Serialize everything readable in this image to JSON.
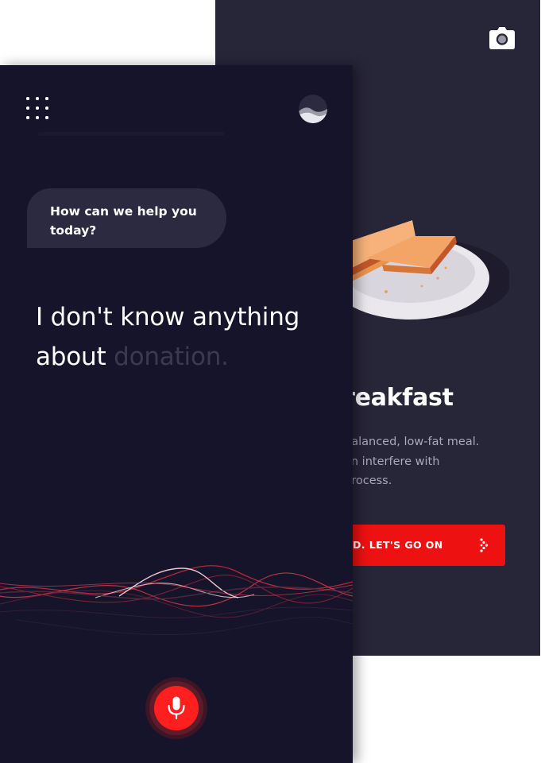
{
  "back_screen": {
    "title": "breakfast",
    "description_lines": [
      "balanced, low-fat meal.",
      "an interfere with",
      "process."
    ],
    "cta_label": "OD. LET'S GO ON",
    "icons": {
      "camera": "camera-icon",
      "cta_arrow": "chevron-right-icon"
    },
    "colors": {
      "background": "#272538",
      "cta": "#ee1111"
    }
  },
  "front_screen": {
    "chat_prompt": "How can we help you today?",
    "transcript": {
      "spoken": "I don't know anything about",
      "pending": "donation."
    },
    "icons": {
      "menu": "grid-menu-icon",
      "avatar": "avatar-icon",
      "mic": "microphone-icon"
    },
    "colors": {
      "background": "#15142a",
      "accent": "#ff1f1f",
      "bubble": "#2c2a40"
    }
  }
}
